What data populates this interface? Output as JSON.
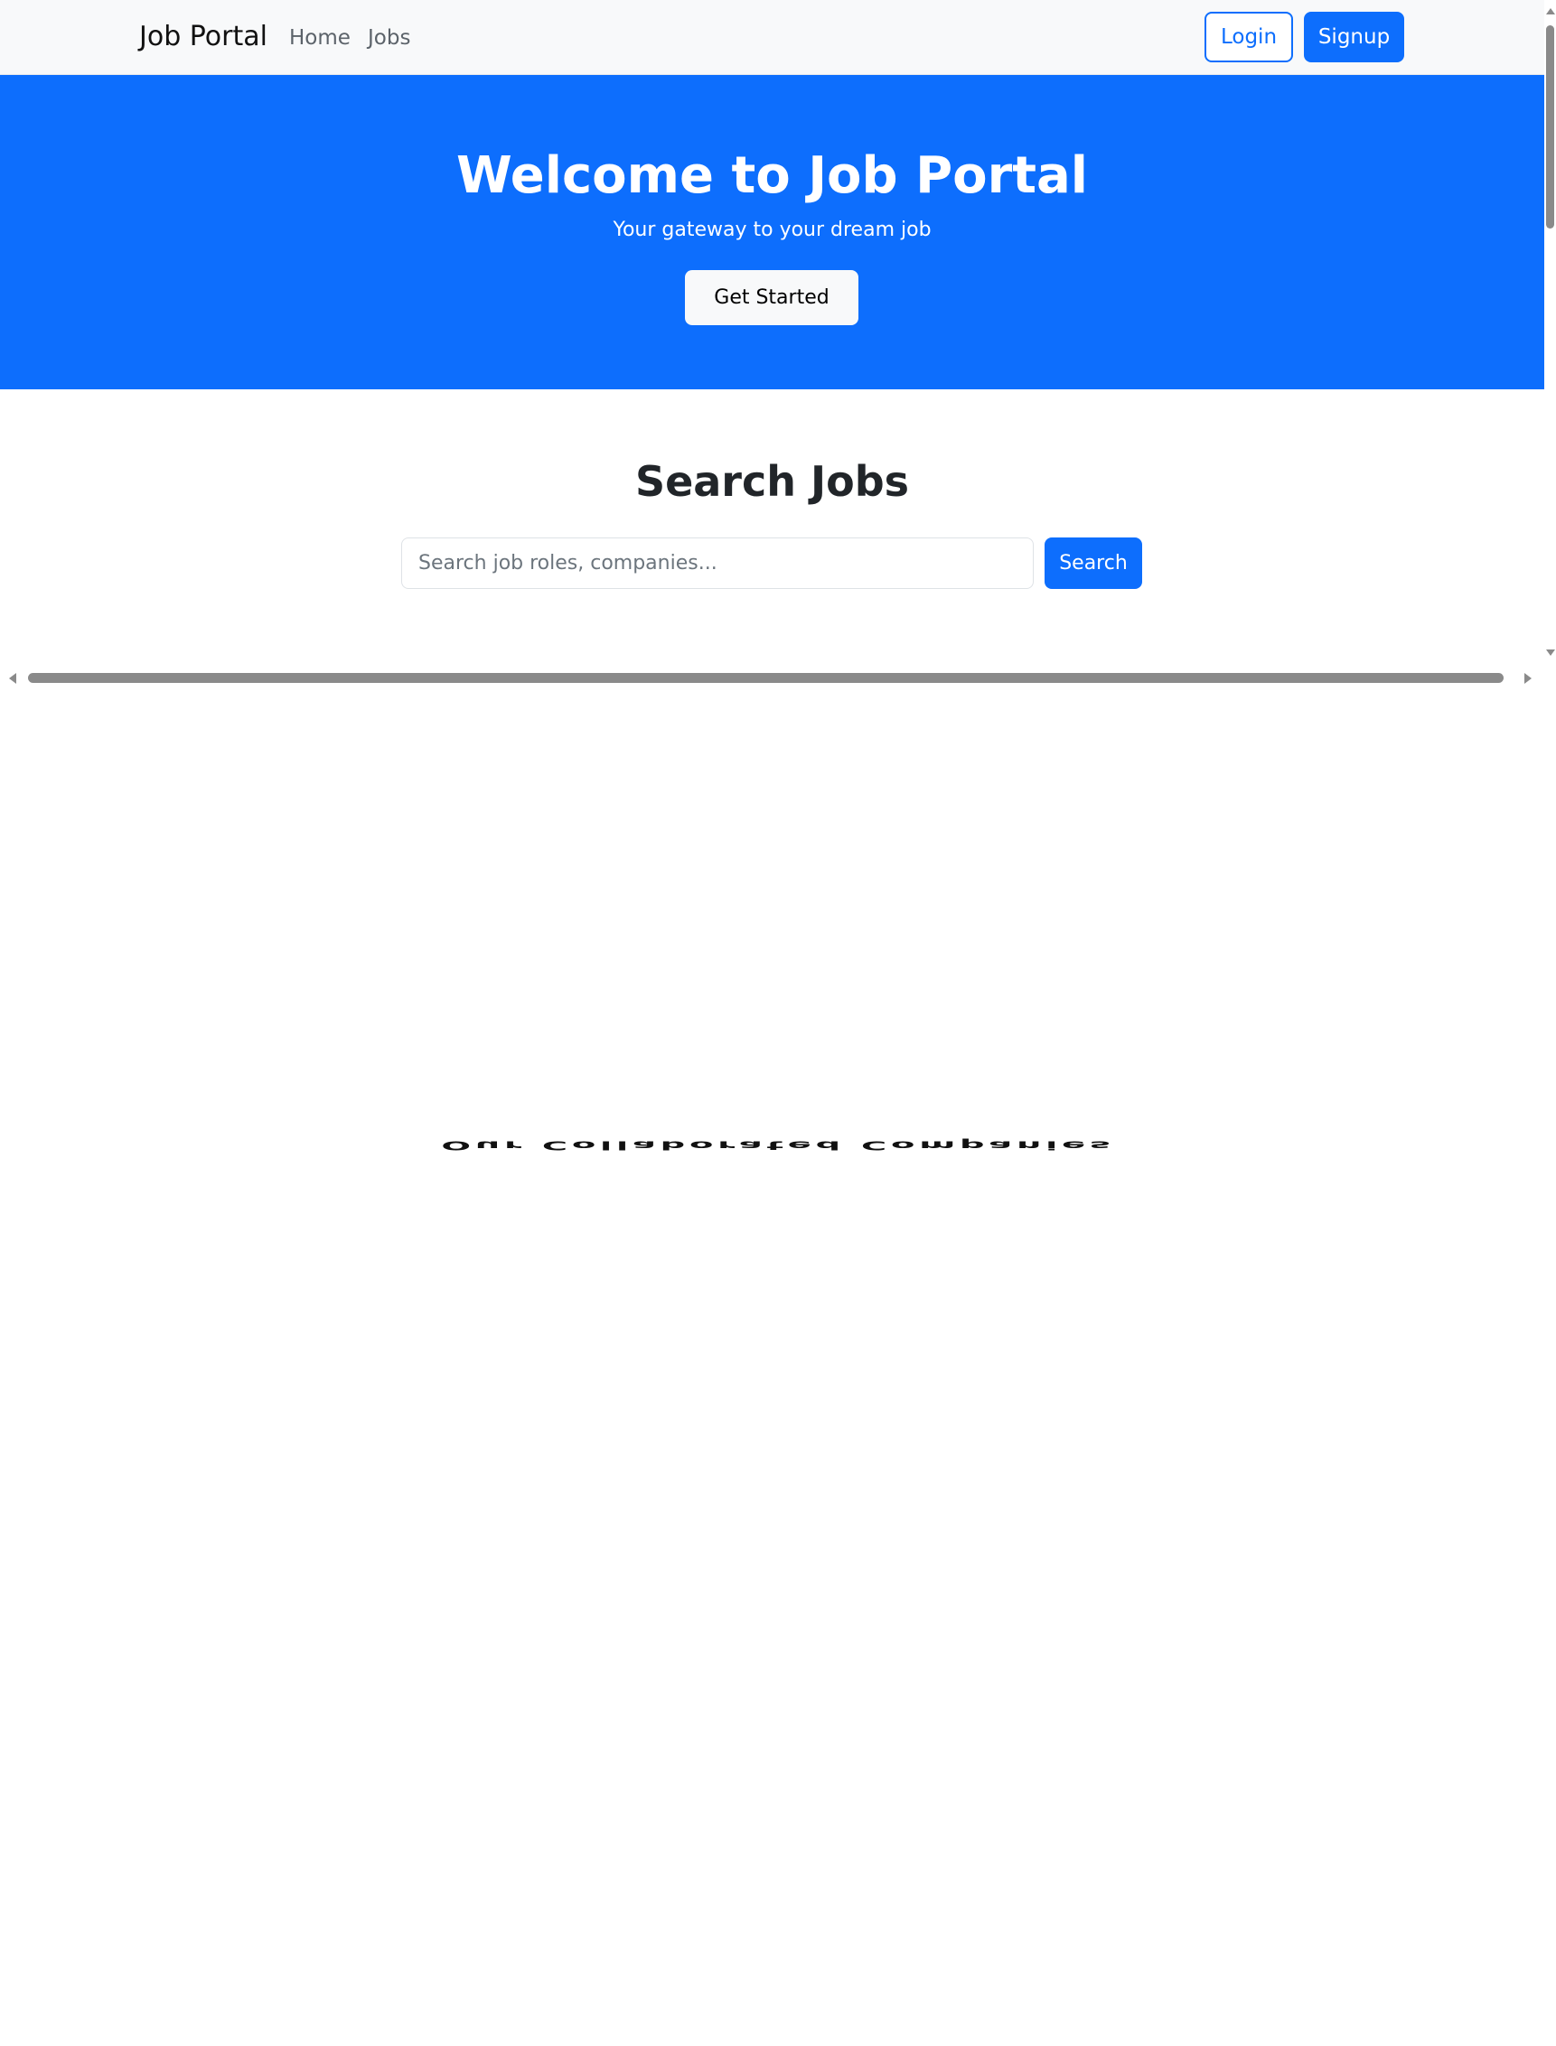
{
  "navbar": {
    "brand": "Job Portal",
    "links": [
      "Home",
      "Jobs"
    ],
    "login_label": "Login",
    "signup_label": "Signup"
  },
  "hero": {
    "title": "Welcome to Job Portal",
    "subtitle": "Your gateway to your dream job",
    "cta_label": "Get Started"
  },
  "search": {
    "title": "Search Jobs",
    "placeholder": "Search job roles, companies...",
    "value": "",
    "button_label": "Search"
  },
  "companies": {
    "heading": "Our Collaborated Companies"
  },
  "colors": {
    "primary": "#0d6efd",
    "navbar_bg": "#f8f9fa",
    "text": "#212529"
  },
  "scrollbars": {
    "vertical_icons": [
      "arrow-up-icon",
      "arrow-down-icon"
    ],
    "horizontal_icons": [
      "arrow-left-icon",
      "arrow-right-icon"
    ]
  }
}
